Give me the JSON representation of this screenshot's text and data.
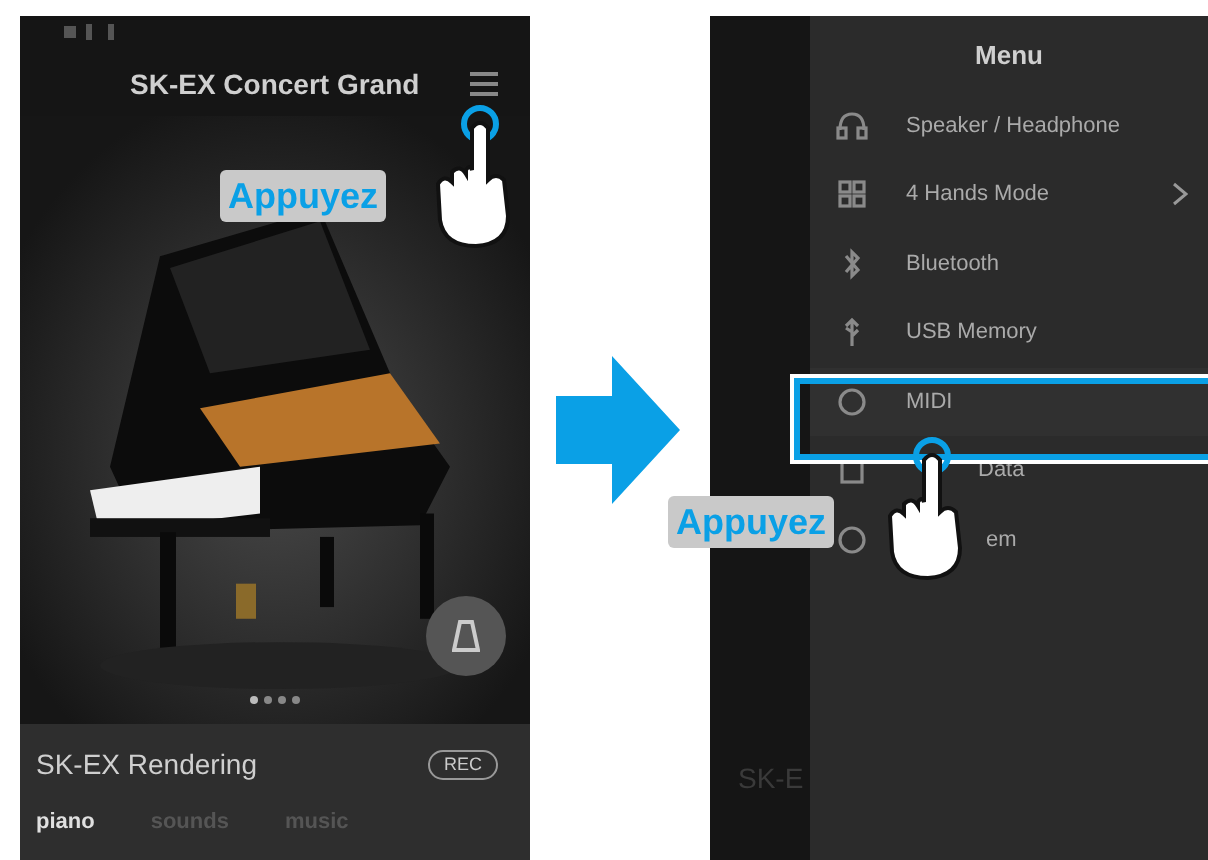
{
  "left_screen": {
    "title": "SK-EX Concert Grand",
    "bottom_panel": {
      "sound_name": "SK-EX Rendering",
      "rec_button": "REC",
      "tabs": [
        {
          "label": "piano",
          "selected": true
        },
        {
          "label": "sounds",
          "selected": false
        },
        {
          "label": "music",
          "selected": false
        }
      ]
    }
  },
  "right_screen": {
    "background_text": "SK-E",
    "menu_title": "Menu",
    "items": [
      {
        "label": "Speaker / Headphone",
        "kind": "plain",
        "submenu": false,
        "selected": false
      },
      {
        "label": "4 Hands Mode",
        "kind": "plain",
        "submenu": true,
        "selected": false
      },
      {
        "label": "Bluetooth",
        "kind": "plain",
        "submenu": false,
        "selected": false
      },
      {
        "label": "USB Memory",
        "kind": "plain",
        "submenu": false,
        "selected": false
      },
      {
        "label": "MIDI",
        "kind": "plain",
        "submenu": false,
        "selected": true
      },
      {
        "label": "Data",
        "kind": "covered",
        "submenu": false,
        "selected": false
      },
      {
        "label": "em",
        "kind": "covered",
        "submenu": false,
        "selected": false
      }
    ]
  },
  "callouts": [
    {
      "label": "Appuyez"
    },
    {
      "label": "Appuyez"
    }
  ]
}
